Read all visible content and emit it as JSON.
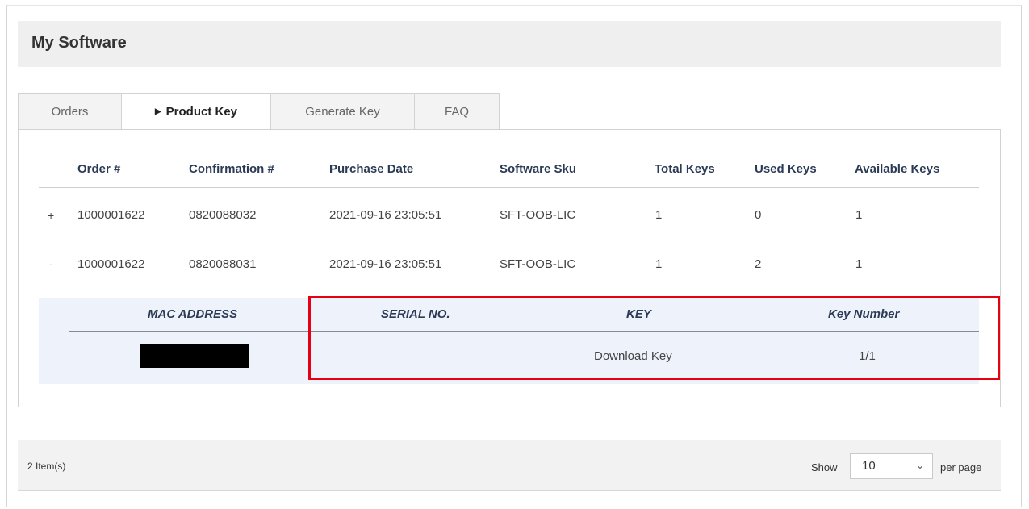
{
  "page": {
    "title": "My Software"
  },
  "tabs": [
    {
      "label": "Orders",
      "active": false
    },
    {
      "label": "Product Key",
      "active": true
    },
    {
      "label": "Generate Key",
      "active": false
    },
    {
      "label": "FAQ",
      "active": false
    }
  ],
  "table": {
    "columns": [
      "Order #",
      "Confirmation #",
      "Purchase Date",
      "Software Sku",
      "Total Keys",
      "Used Keys",
      "Available Keys"
    ],
    "rows": [
      {
        "toggle": "+",
        "order": "1000001622",
        "confirmation": "0820088032",
        "purchase_date": "2021-09-16 23:05:51",
        "sku": "SFT-OOB-LIC",
        "total": "1",
        "used": "0",
        "available": "1"
      },
      {
        "toggle": "-",
        "order": "1000001622",
        "confirmation": "0820088031",
        "purchase_date": "2021-09-16 23:05:51",
        "sku": "SFT-OOB-LIC",
        "total": "1",
        "used": "2",
        "available": "1"
      }
    ]
  },
  "detail": {
    "columns": [
      "MAC ADDRESS",
      "SERIAL NO.",
      "KEY",
      "Key Number"
    ],
    "row": {
      "mac": "",
      "serial": "",
      "key_link": "Download Key",
      "key_number": "1/1"
    }
  },
  "footer": {
    "items_count": "2 Item(s)",
    "show_label": "Show",
    "per_page_value": "10",
    "per_page_label": "per page"
  },
  "colors": {
    "highlight": "#e60012",
    "detail_bg": "#eef3fb",
    "header_text": "#2b3b55"
  }
}
